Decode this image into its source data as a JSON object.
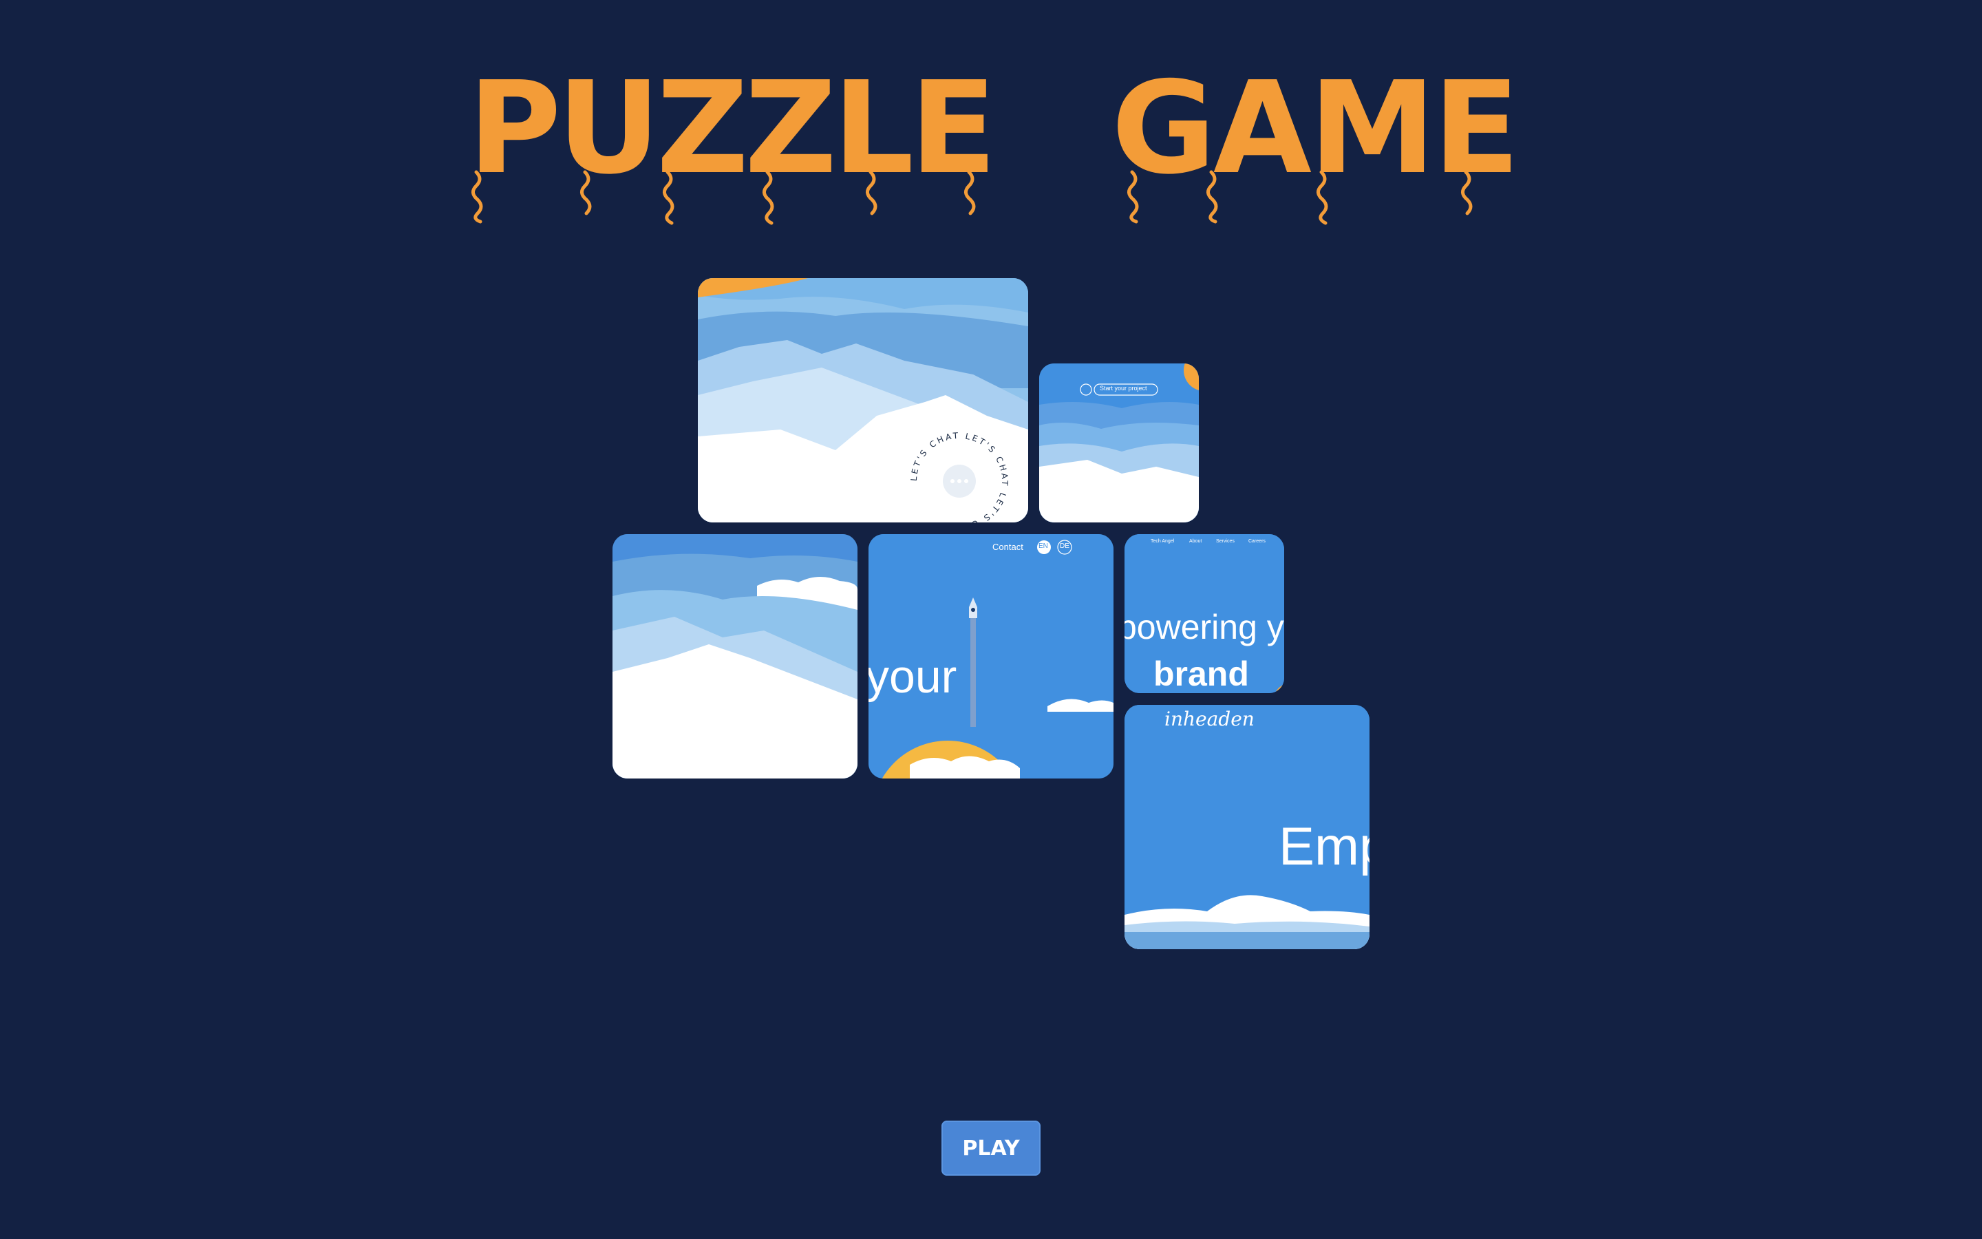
{
  "title": {
    "word1": "PUZZLE",
    "word2": "GAME",
    "color": "#f39c38"
  },
  "background": "#132143",
  "pieces": {
    "top_left": {
      "chat_ring": "LET'S CHAT LET'S CHAT LET'S CHAT"
    },
    "top_right": {
      "cta": "Start your project"
    },
    "mid_center": {
      "nav_contact": "Contact",
      "lang_en": "EN",
      "lang_de": "DE",
      "hero_word": "your"
    },
    "mid_right": {
      "nav": [
        "Tech Angel",
        "About",
        "Services",
        "Careers"
      ],
      "hero_line1": "powering y",
      "hero_line2": "brand"
    },
    "bottom_right": {
      "logo": "inheaden",
      "hero_word": "Emp"
    }
  },
  "play_button": {
    "label": "PLAY"
  },
  "colors": {
    "tile_blue": "#4190e0",
    "snow": "#ffffff",
    "sun": "#f5b942",
    "accent_orange": "#f39c38"
  }
}
